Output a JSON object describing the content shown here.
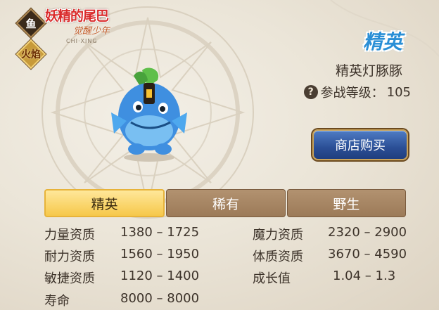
{
  "tags": [
    "鱼",
    "火焰"
  ],
  "logo": {
    "line1": "妖精的尾巴",
    "line2": "觉醒少年",
    "line3": "CHI·XING"
  },
  "rank": "精英",
  "pet_name": "精英灯豚豚",
  "battle_level": {
    "label": "参战等级：",
    "value": "105"
  },
  "shop_button": "商店购买",
  "tabs": [
    {
      "label": "精英",
      "active": true
    },
    {
      "label": "稀有",
      "active": false
    },
    {
      "label": "野生",
      "active": false
    }
  ],
  "stats": [
    {
      "label": "力量资质",
      "value": "1380 – 1725"
    },
    {
      "label": "魔力资质",
      "value": "2320 – 2900"
    },
    {
      "label": "耐力资质",
      "value": "1560 – 1950"
    },
    {
      "label": "体质资质",
      "value": "3670 – 4590"
    },
    {
      "label": "敏捷资质",
      "value": "1120 – 1400"
    },
    {
      "label": "成长值",
      "value": "1.04 – 1.3"
    },
    {
      "label": "寿命",
      "value": "8000 – 8000"
    }
  ],
  "colors": {
    "rank": "#2a8fd6",
    "active_tab": "#f6c84a",
    "inactive_tab": "#a7866a",
    "shop_button": "#2b4f96"
  }
}
